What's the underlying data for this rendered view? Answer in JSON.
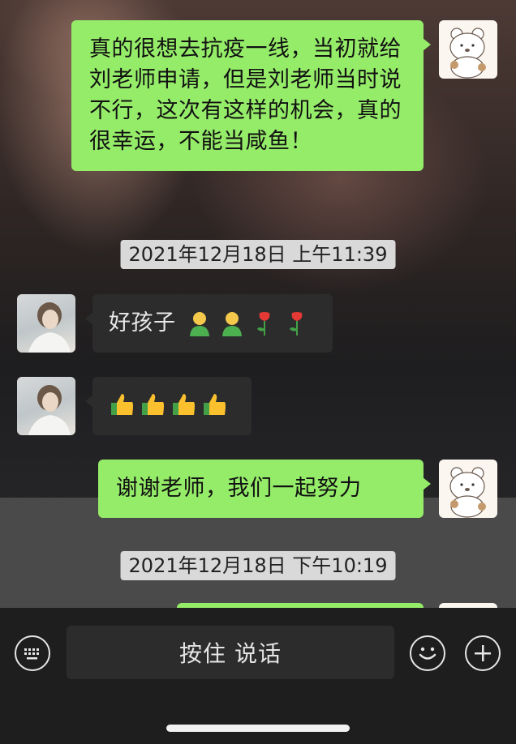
{
  "messages": [
    {
      "side": "out",
      "text": "真的很想去抗疫一线，当初就给刘老师申请，但是刘老师当时说不行，这次有这样的机会，真的很幸运，不能当咸鱼！"
    },
    {
      "type": "timestamp",
      "text": "2021年12月18日 上午11:39"
    },
    {
      "side": "in",
      "text": "好孩子",
      "emojis": [
        "person-emoji",
        "person-emoji",
        "rose-emoji",
        "rose-emoji"
      ]
    },
    {
      "side": "in",
      "emojis": [
        "thumbs-up-emoji",
        "thumbs-up-emoji",
        "thumbs-up-emoji",
        "thumbs-up-emoji"
      ]
    },
    {
      "side": "out",
      "text": "谢谢老师，我们一起努力"
    },
    {
      "type": "timestamp",
      "text": "2021年12月18日 下午10:19"
    }
  ],
  "input_bar": {
    "voice_label": "按住 说话",
    "left_icon": "keyboard-icon",
    "right_icons": [
      "emoji-icon",
      "plus-icon"
    ]
  },
  "colors": {
    "out_bubble": "#95ec69",
    "in_bubble": "#2c2c2c",
    "timestamp_bg": "#d9d9d9"
  }
}
